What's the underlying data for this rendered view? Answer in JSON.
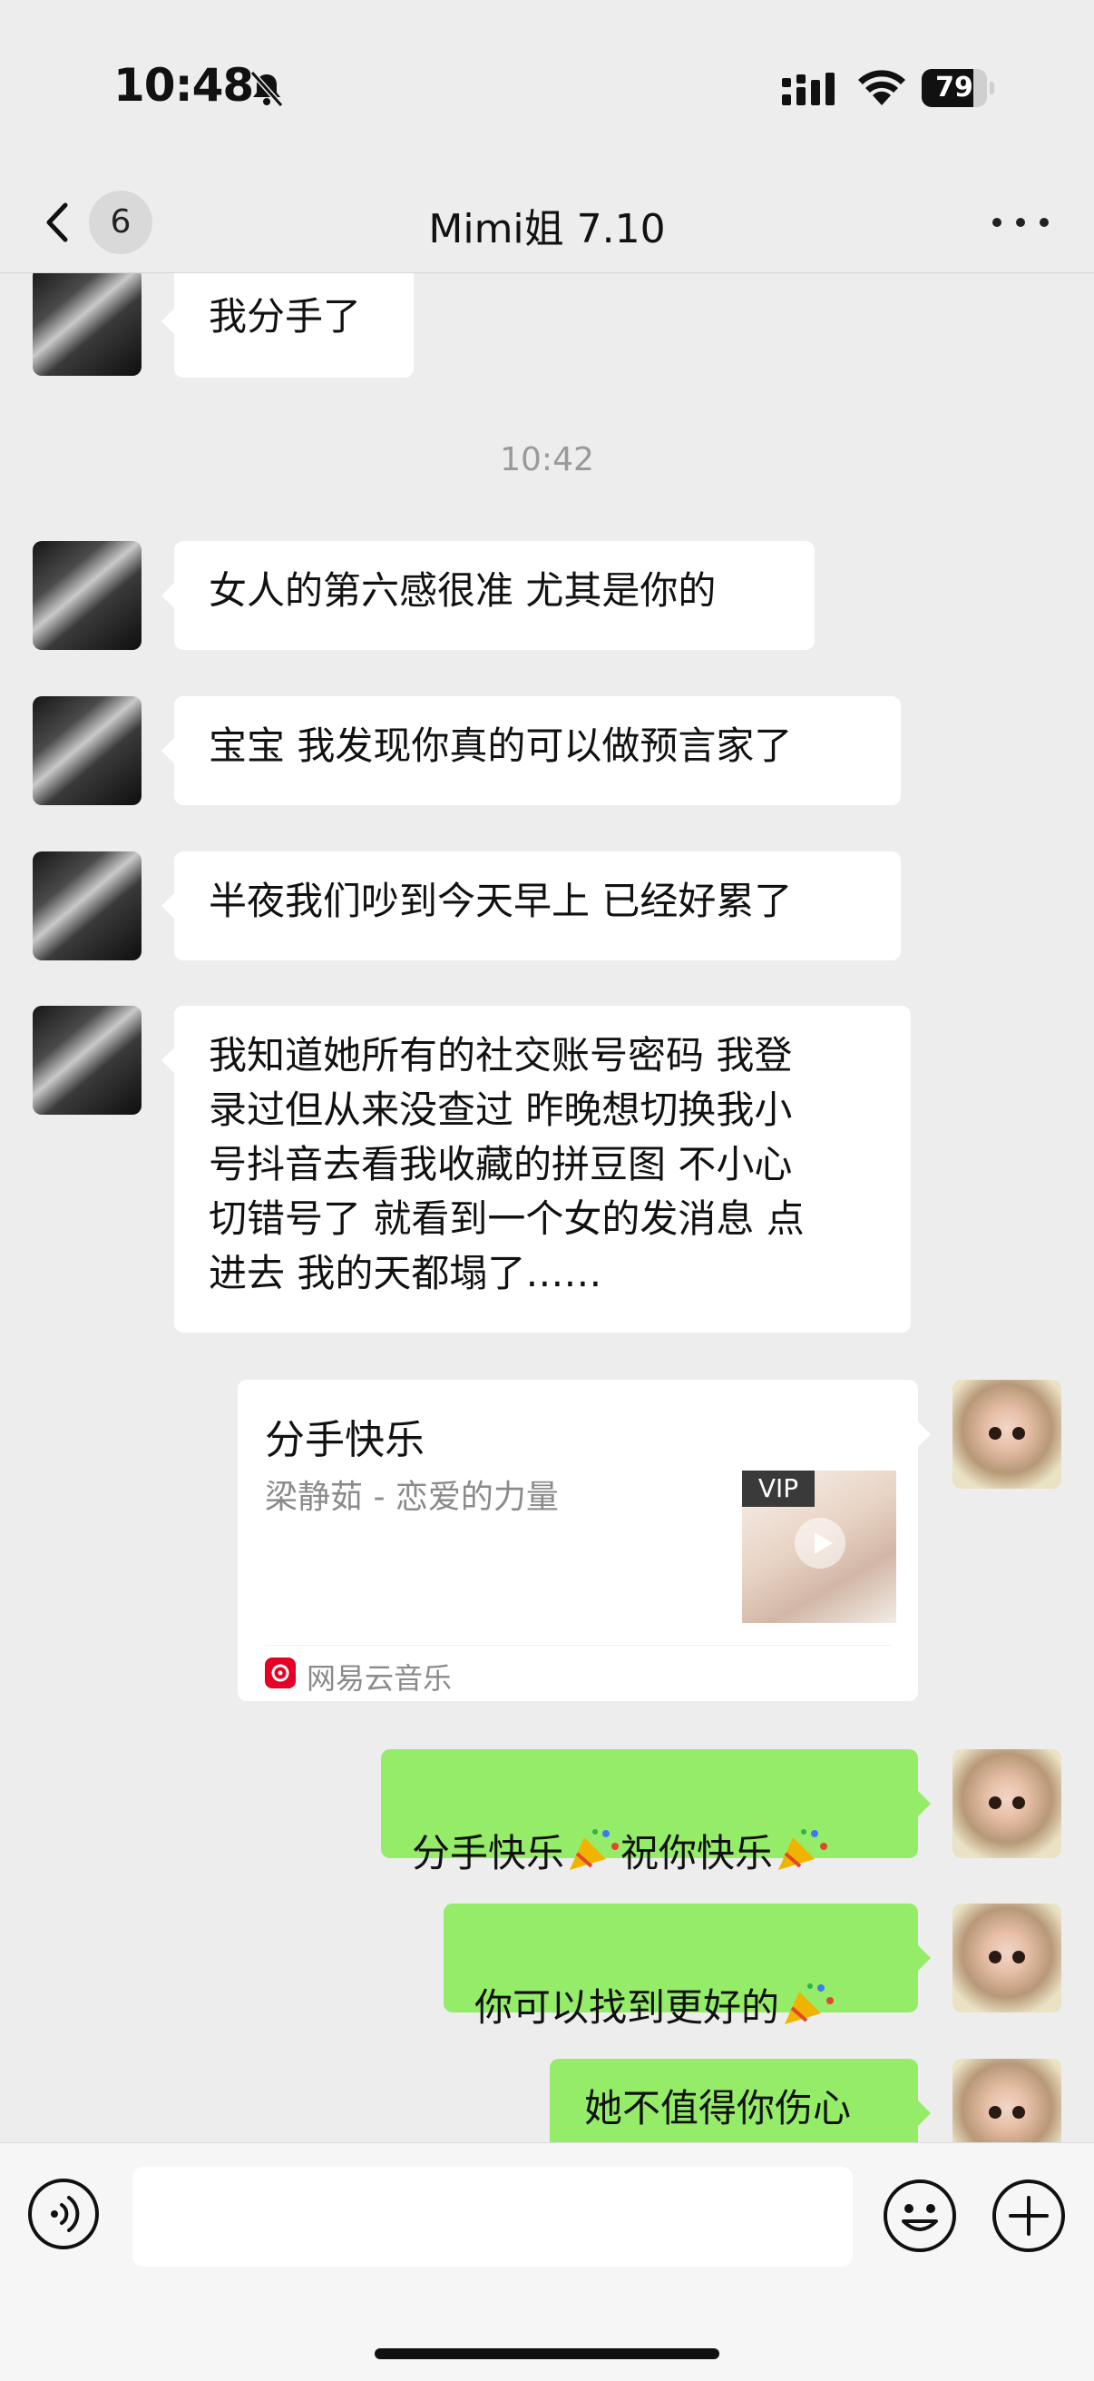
{
  "status_bar": {
    "time": "10:48",
    "battery": "79",
    "battery_level": 0.79,
    "icons": [
      "bell-slash-icon",
      "signal-icon",
      "wifi-icon",
      "battery-icon"
    ]
  },
  "nav": {
    "back_badge": "6",
    "title": "Mimi姐 7.10",
    "more_icon": "ellipsis-icon"
  },
  "messages": {
    "m1": "我分手了",
    "time_1": "10:42",
    "m2": "女人的第六感很准 尤其是你的",
    "m3": "宝宝 我发现你真的可以做预言家了",
    "m4": "半夜我们吵到今天早上 已经好累了",
    "m5": "我知道她所有的社交账号密码 我登\n录过但从来没查过 昨晚想切换我小\n号抖音去看我收藏的拼豆图 不小心\n切错号了 就看到一个女的发消息 点\n进去 我的天都塌了……",
    "music_card": {
      "title": "分手快乐",
      "artist": "梁静茹 - 恋爱的力量",
      "vip": "VIP",
      "source": "网易云音乐"
    },
    "m6_a": "分手快乐",
    "m6_b": "祝你快乐",
    "m7": "你可以找到更好的",
    "m8": "她不值得你伤心"
  },
  "colors": {
    "background": "#ededed",
    "outgoing_bubble": "#95ec69",
    "incoming_bubble": "#ffffff",
    "netease_red": "#e60026"
  },
  "input": {
    "placeholder": "",
    "voice_icon": "voice-icon",
    "emoji_icon": "smiley-icon",
    "plus_icon": "plus-circle-icon"
  }
}
